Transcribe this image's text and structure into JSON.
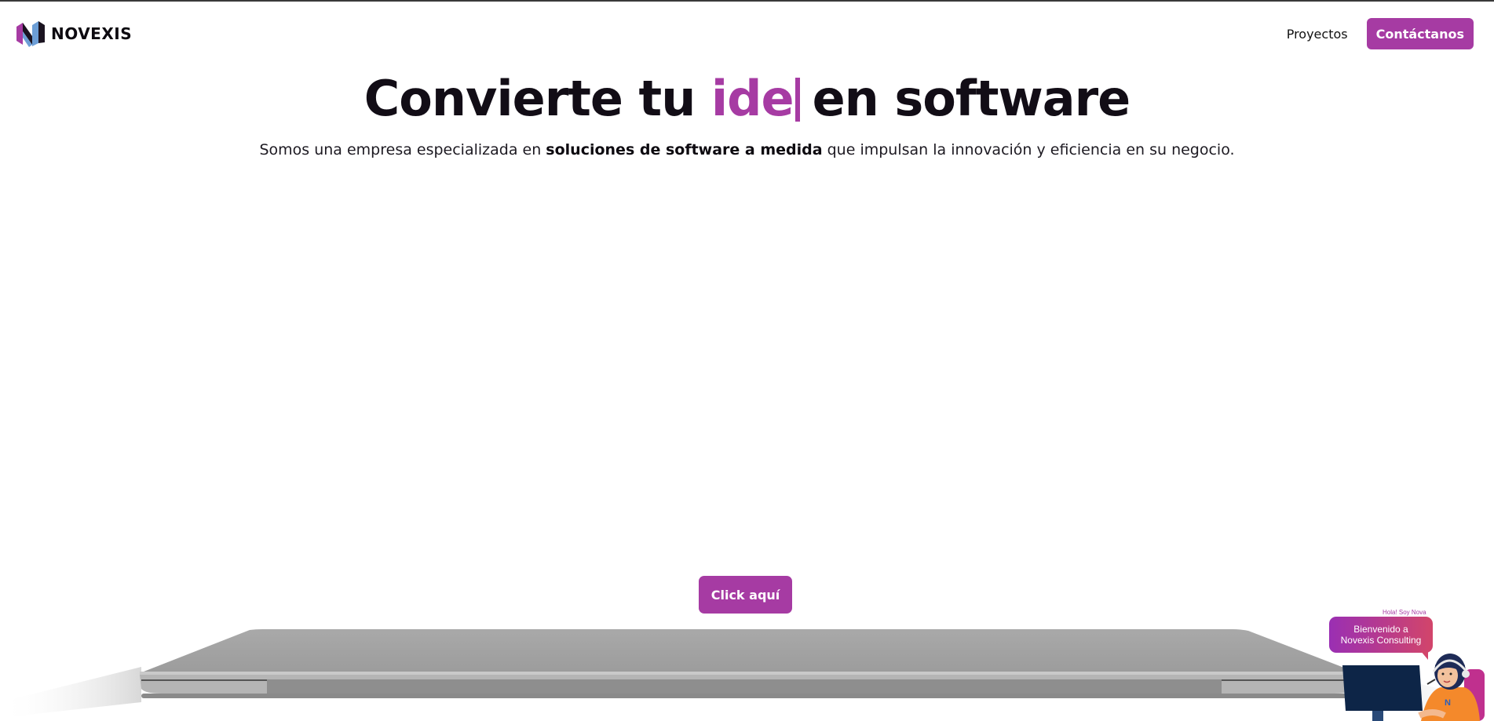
{
  "brand": {
    "name": "NOVEXIS",
    "colors": {
      "accent": "#a63ba3",
      "text": "#120d16",
      "logo_blue": "#6c9ed6"
    }
  },
  "nav": {
    "projects_label": "Proyectos",
    "contact_label": "Contáctanos"
  },
  "hero": {
    "title_before": "Convierte tu ",
    "title_accent": "ide",
    "title_after": "en software",
    "subtitle_before": "Somos una empresa especializada en ",
    "subtitle_bold": "soluciones de software a medida",
    "subtitle_after": " que impulsan la innovación y eficiencia en su negocio.",
    "cta_label": "Click aquí"
  },
  "chat": {
    "greeting": "Hola! Soy Nova",
    "bubble_line1": "Bienvenido a",
    "bubble_line2": "Novexis Consulting"
  },
  "icons": {
    "logo": "novexis-logo-icon",
    "avatar": "assistant-avatar-icon",
    "laptop": "laptop-illustration"
  }
}
